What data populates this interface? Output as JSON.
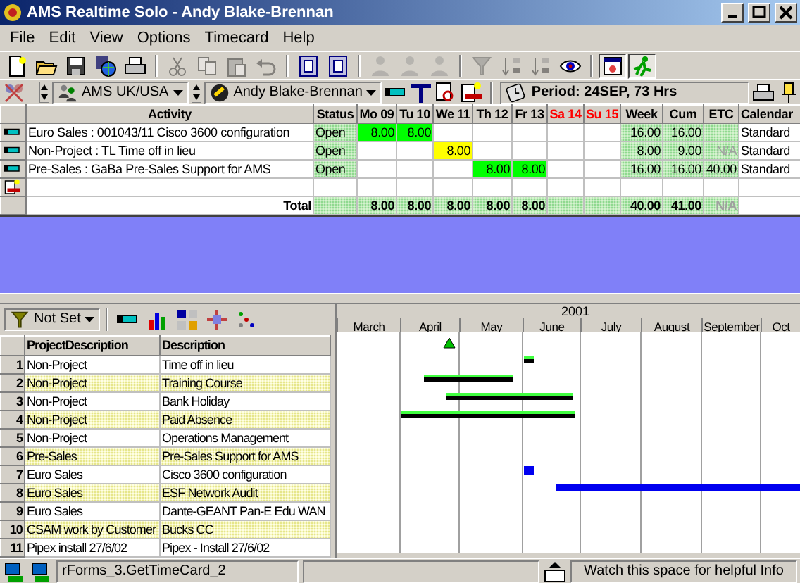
{
  "window": {
    "title": "AMS Realtime Solo - Andy Blake-Brennan"
  },
  "menu": [
    "File",
    "Edit",
    "View",
    "Options",
    "Timecard",
    "Help"
  ],
  "toolbar": [
    {
      "kind": "new",
      "disabled": false,
      "pressed": false
    },
    {
      "kind": "open",
      "disabled": false,
      "pressed": false
    },
    {
      "kind": "save",
      "disabled": false,
      "pressed": false
    },
    {
      "kind": "globe",
      "disabled": false,
      "pressed": false
    },
    {
      "kind": "print",
      "disabled": false,
      "pressed": false
    },
    {
      "kind": "separator"
    },
    {
      "kind": "cut",
      "disabled": true,
      "pressed": false
    },
    {
      "kind": "copy",
      "disabled": true,
      "pressed": false
    },
    {
      "kind": "paste",
      "disabled": true,
      "pressed": false
    },
    {
      "kind": "undo",
      "disabled": true,
      "pressed": false
    },
    {
      "kind": "separator"
    },
    {
      "kind": "card",
      "disabled": false,
      "pressed": false
    },
    {
      "kind": "card",
      "disabled": false,
      "pressed": false
    },
    {
      "kind": "separator"
    },
    {
      "kind": "person",
      "disabled": true,
      "pressed": false
    },
    {
      "kind": "person",
      "disabled": true,
      "pressed": false
    },
    {
      "kind": "person",
      "disabled": true,
      "pressed": false
    },
    {
      "kind": "separator"
    },
    {
      "kind": "filter",
      "disabled": true,
      "pressed": false
    },
    {
      "kind": "sort",
      "disabled": true,
      "pressed": false
    },
    {
      "kind": "sort",
      "disabled": true,
      "pressed": false
    },
    {
      "kind": "eye",
      "disabled": false,
      "pressed": false
    },
    {
      "kind": "separator"
    },
    {
      "kind": "window",
      "disabled": false,
      "pressed": true
    },
    {
      "kind": "runner",
      "disabled": false,
      "pressed": true
    }
  ],
  "selector_bar": {
    "organisation": "AMS UK/USA",
    "user": "Andy Blake-Brennan",
    "period": "Period: 24SEP, 73 Hrs"
  },
  "timecard": {
    "columns": [
      {
        "label": "Activity",
        "weekend": false
      },
      {
        "label": "Status",
        "weekend": false
      },
      {
        "label": "Mo 09",
        "weekend": false
      },
      {
        "label": "Tu 10",
        "weekend": false
      },
      {
        "label": "We 11",
        "weekend": false
      },
      {
        "label": "Th 12",
        "weekend": false
      },
      {
        "label": "Fr 13",
        "weekend": false
      },
      {
        "label": "Sa 14",
        "weekend": true
      },
      {
        "label": "Su 15",
        "weekend": true
      },
      {
        "label": "Week",
        "weekend": false
      },
      {
        "label": "Cum",
        "weekend": false
      },
      {
        "label": "ETC",
        "weekend": false
      },
      {
        "label": "Calendar",
        "weekend": false
      }
    ],
    "rows": [
      {
        "activity": "Euro Sales : 001043/11 Cisco 3600 configuration",
        "status": "Open",
        "days": [
          {
            "value": "8.00",
            "color": "#00ff00"
          },
          {
            "value": "8.00",
            "color": "#00ff00"
          },
          {
            "color": "#ffffff"
          },
          {
            "color": "#ffffff"
          },
          {
            "color": "#ffffff"
          },
          {
            "color": "#ffffff"
          },
          {
            "color": "#ffffff"
          }
        ],
        "week": "16.00",
        "cum": "16.00",
        "calendar": "Standard"
      },
      {
        "activity": "Non-Project : TL Time off in lieu",
        "status": "Open",
        "days": [
          {
            "color": "#ffffff"
          },
          {
            "color": "#ffffff"
          },
          {
            "value": "8.00",
            "color": "#ffff00"
          },
          {
            "color": "#ffffff"
          },
          {
            "color": "#ffffff"
          },
          {
            "color": "#ffffff"
          },
          {
            "color": "#ffffff"
          }
        ],
        "week": "8.00",
        "cum": "9.00",
        "etc": {
          "text": "N/A",
          "disabled": true
        },
        "calendar": "Standard"
      },
      {
        "activity": "Pre-Sales : GaBa Pre-Sales Support for AMS",
        "status": "Open",
        "days": [
          {
            "color": "#ffffff"
          },
          {
            "color": "#ffffff"
          },
          {
            "color": "#ffffff"
          },
          {
            "value": "8.00",
            "color": "#00ff00"
          },
          {
            "value": "8.00",
            "color": "#00ff00"
          },
          {
            "color": "#ffffff"
          },
          {
            "color": "#ffffff"
          }
        ],
        "week": "16.00",
        "cum": "16.00",
        "etc": {
          "text": "40.00",
          "disabled": false
        },
        "calendar": "Standard"
      }
    ],
    "total": {
      "label": "Total",
      "days": [
        "8.00",
        "8.00",
        "8.00",
        "8.00",
        "8.00"
      ],
      "week": "40.00",
      "cum": "41.00",
      "etc": {
        "text": "N/A",
        "disabled": true
      }
    }
  },
  "project_pane": {
    "filter": "Not Set",
    "columns": [
      "ProjectDescription",
      "Description"
    ],
    "rows": [
      {
        "number": "1",
        "project": "Non-Project",
        "description": "Time off in lieu"
      },
      {
        "number": "2",
        "project": "Non-Project",
        "description": "Training Course"
      },
      {
        "number": "3",
        "project": "Non-Project",
        "description": "Bank Holiday"
      },
      {
        "number": "4",
        "project": "Non-Project",
        "description": "Paid Absence"
      },
      {
        "number": "5",
        "project": "Non-Project",
        "description": "Operations Management"
      },
      {
        "number": "6",
        "project": "Pre-Sales",
        "description": "Pre-Sales Support for AMS"
      },
      {
        "number": "7",
        "project": "Euro Sales",
        "description": "Cisco 3600 configuration"
      },
      {
        "number": "8",
        "project": "Euro Sales",
        "description": "ESF Network Audit"
      },
      {
        "number": "9",
        "project": "Euro Sales",
        "description": "Dante-GEANT Pan-E Edu WAN"
      },
      {
        "number": "10",
        "project": "CSAM work by Customer",
        "description": "Bucks CC"
      },
      {
        "number": "11",
        "project": "Pipex install 27/6/02",
        "description": "Pipex - Install 27/6/02"
      }
    ]
  },
  "gantt": {
    "year": "2001",
    "months": [
      "March",
      "April",
      "May",
      "June",
      "July",
      "August",
      "September",
      "Oct"
    ]
  },
  "status_bar": {
    "form": "rForms_3.GetTimeCard_2",
    "info": "Watch this space for helpful Info"
  }
}
